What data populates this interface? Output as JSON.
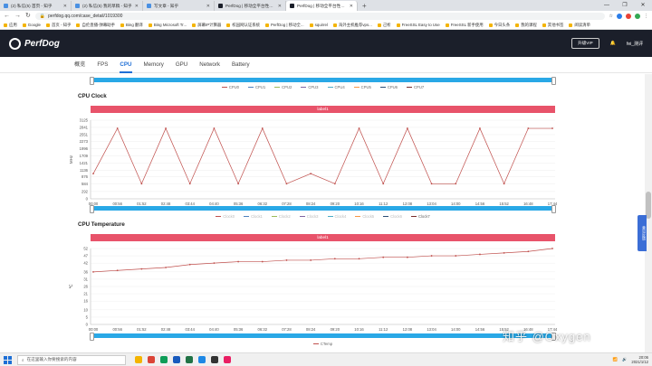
{
  "browser": {
    "tabs": [
      {
        "label": "(2) 私信(5) 首页 - 知乎",
        "active": false
      },
      {
        "label": "(2) 私信(5) 我的草稿 - 知乎",
        "active": false
      },
      {
        "label": "写文章 - 知乎",
        "active": false
      },
      {
        "label": "PerfDog | 移动全平台性能测试...",
        "active": false
      },
      {
        "label": "PerfDog | 移动全平台性能测试...",
        "active": true
      }
    ],
    "new_tab": "+",
    "window_controls": [
      "—",
      "❐",
      "✕"
    ],
    "url": "perfdog.qq.com/case_detail/1019300",
    "bookmarks": [
      "应用",
      "Google",
      "首页 - 知乎",
      "自伦直播-弹幕助手",
      "Bing 翻译",
      "Bing Microsoft Tr...",
      "屏幕IP计算器",
      "校园网认证系统",
      "PerfDog | 移动全...",
      "squirrel",
      "海外主机推荐vps...",
      "己析",
      "FreeSSL Easy to Use",
      "FreeSSL 新手使用",
      "今日头条",
      "我的课程",
      "其他书签",
      "阅读清单"
    ]
  },
  "app": {
    "logo_text": "PerfDog",
    "header_button": "升级VIP",
    "user_name": "fei_测评",
    "nav_tabs": [
      "概览",
      "FPS",
      "CPU",
      "Memory",
      "GPU",
      "Network",
      "Battery"
    ],
    "active_tab": "CPU"
  },
  "cpu_usage_legend": [
    "CPU0",
    "CPU1",
    "CPU2",
    "CPU3",
    "CPU4",
    "CPU5",
    "CPU6",
    "CPU7"
  ],
  "clock": {
    "title": "CPU Clock",
    "label_bar": "label1",
    "legend": [
      "Clock0",
      "Clock1",
      "Clock2",
      "Clock3",
      "Clock4",
      "Clock5",
      "Clock6",
      "Clock7"
    ]
  },
  "temperature": {
    "title": "CPU Temperature",
    "label_bar": "label1",
    "legend": [
      "CTemp"
    ]
  },
  "x_ticks": [
    "00:00",
    "00:56",
    "01:52",
    "02:48",
    "03:44",
    "04:40",
    "05:36",
    "06:32",
    "07:28",
    "08:24",
    "09:20",
    "10:16",
    "11:12",
    "12:08",
    "13:04",
    "14:00",
    "14:56",
    "15:52",
    "16:48",
    "17:44"
  ],
  "chart_data": [
    {
      "type": "line",
      "title": "CPU Clock",
      "ylabel": "MHz",
      "y_ticks": [
        0,
        292,
        584,
        876,
        1136,
        1421,
        1709,
        1996,
        2273,
        2551,
        2841,
        3125
      ],
      "ylim": [
        0,
        3125
      ],
      "x": [
        "00:00",
        "00:56",
        "01:52",
        "02:48",
        "03:44",
        "04:40",
        "05:36",
        "06:32",
        "07:28",
        "08:24",
        "09:20",
        "10:16",
        "11:12",
        "12:08",
        "13:04",
        "14:00",
        "14:56",
        "15:52",
        "16:48",
        "17:44"
      ],
      "series": [
        {
          "name": "Clock7",
          "values": [
            1000,
            2800,
            600,
            2800,
            600,
            2800,
            600,
            2800,
            600,
            1000,
            600,
            2800,
            600,
            2800,
            600,
            600,
            2800,
            600,
            2800,
            2800
          ]
        }
      ],
      "grid": true,
      "legend_position": "top"
    },
    {
      "type": "line",
      "title": "CPU Temperature",
      "ylabel": "℃",
      "y_ticks": [
        0,
        5,
        10,
        16,
        21,
        26,
        31,
        36,
        42,
        47,
        52
      ],
      "ylim": [
        0,
        52
      ],
      "x": [
        "00:00",
        "00:56",
        "01:52",
        "02:48",
        "03:44",
        "04:40",
        "05:36",
        "06:32",
        "07:28",
        "08:24",
        "09:20",
        "10:16",
        "11:12",
        "12:08",
        "13:04",
        "14:00",
        "14:56",
        "15:52",
        "16:48",
        "17:44"
      ],
      "series": [
        {
          "name": "CTemp",
          "values": [
            36,
            37,
            38,
            39,
            41,
            42,
            43,
            43,
            44,
            44,
            45,
            45,
            46,
            46,
            47,
            47,
            48,
            49,
            50,
            52
          ]
        }
      ],
      "grid": true,
      "legend_position": "bottom"
    }
  ],
  "watermark": "知乎 @Oxygen",
  "feedback_tab": "意见反馈",
  "taskbar": {
    "search_placeholder": "在这里输入你要搜索的内容",
    "time": "20:06",
    "date": "2021/1/12"
  },
  "colors": {
    "accent": "#1f6fd6",
    "label_bar": "#e8536a",
    "slider": "#29a8e6",
    "line": "#c0504d",
    "header": "#1b1f2a"
  }
}
